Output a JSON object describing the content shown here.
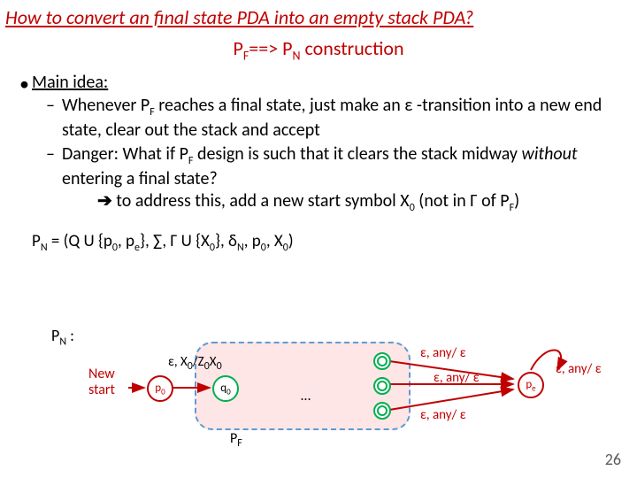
{
  "title": "How to convert an final state PDA into an empty stack PDA?",
  "subtitle": {
    "p": "P",
    "f": "F",
    "arrow": "==>",
    "p2": "P",
    "n": "N",
    "rest": " construction"
  },
  "main_idea": {
    "bullet": "•",
    "label": "Main idea:"
  },
  "idea1": {
    "dash": "–",
    "a": "Whenever P",
    "fsub": "F",
    "b": " reaches a final state, just make an ",
    "eps": "ε",
    "c": " -transition into a new end state, clear out the stack and accept"
  },
  "idea2": {
    "dash": "–",
    "a": "Danger: What if P",
    "fsub": "F",
    "b": " design is such that it clears the stack midway ",
    "without": "without",
    "c": " entering a final state?"
  },
  "idea3": {
    "arrow": "➔",
    "a": " to address this, add a new start symbol X",
    "zsub": "0",
    "b": " (not in ",
    "gamma": "Γ",
    "c": " of P",
    "fsub": "F",
    "d": ")"
  },
  "pn_def": {
    "a": "P",
    "nsub": "N",
    "b": " = (Q U {p",
    "z0": "0",
    "c": ", p",
    "esub": "e",
    "d": "}, ",
    "sigma": "∑",
    "e": ", ",
    "gamma": "Γ",
    "f": " U {X",
    "z0b": "0",
    "g": "}, δ",
    "nsub2": "N",
    "h": ", p",
    "z0c": "0",
    "i": ", X",
    "z0d": "0",
    "j": ")"
  },
  "diag": {
    "pn_label_a": "P",
    "pn_label_sub": "N",
    "pn_label_b": " :",
    "new_start": "New\nstart",
    "p0": "p",
    "p0_sub": "0",
    "q0": "q",
    "q0_sub": "0",
    "pe": "p",
    "pe_sub": "e",
    "edge1_a": "ε, X",
    "edge1_sub1": "0",
    "edge1_b": "/Z",
    "edge1_sub2": "0",
    "edge1_c": "X",
    "edge1_sub3": "0",
    "any1": "ε, any/ ε",
    "any2": "ε, any/ ε",
    "any3": "ε, any/ ε",
    "any4": "ε, any/ ε",
    "dots": "…",
    "pf": "P",
    "pf_sub": "F"
  },
  "page_num": "26"
}
